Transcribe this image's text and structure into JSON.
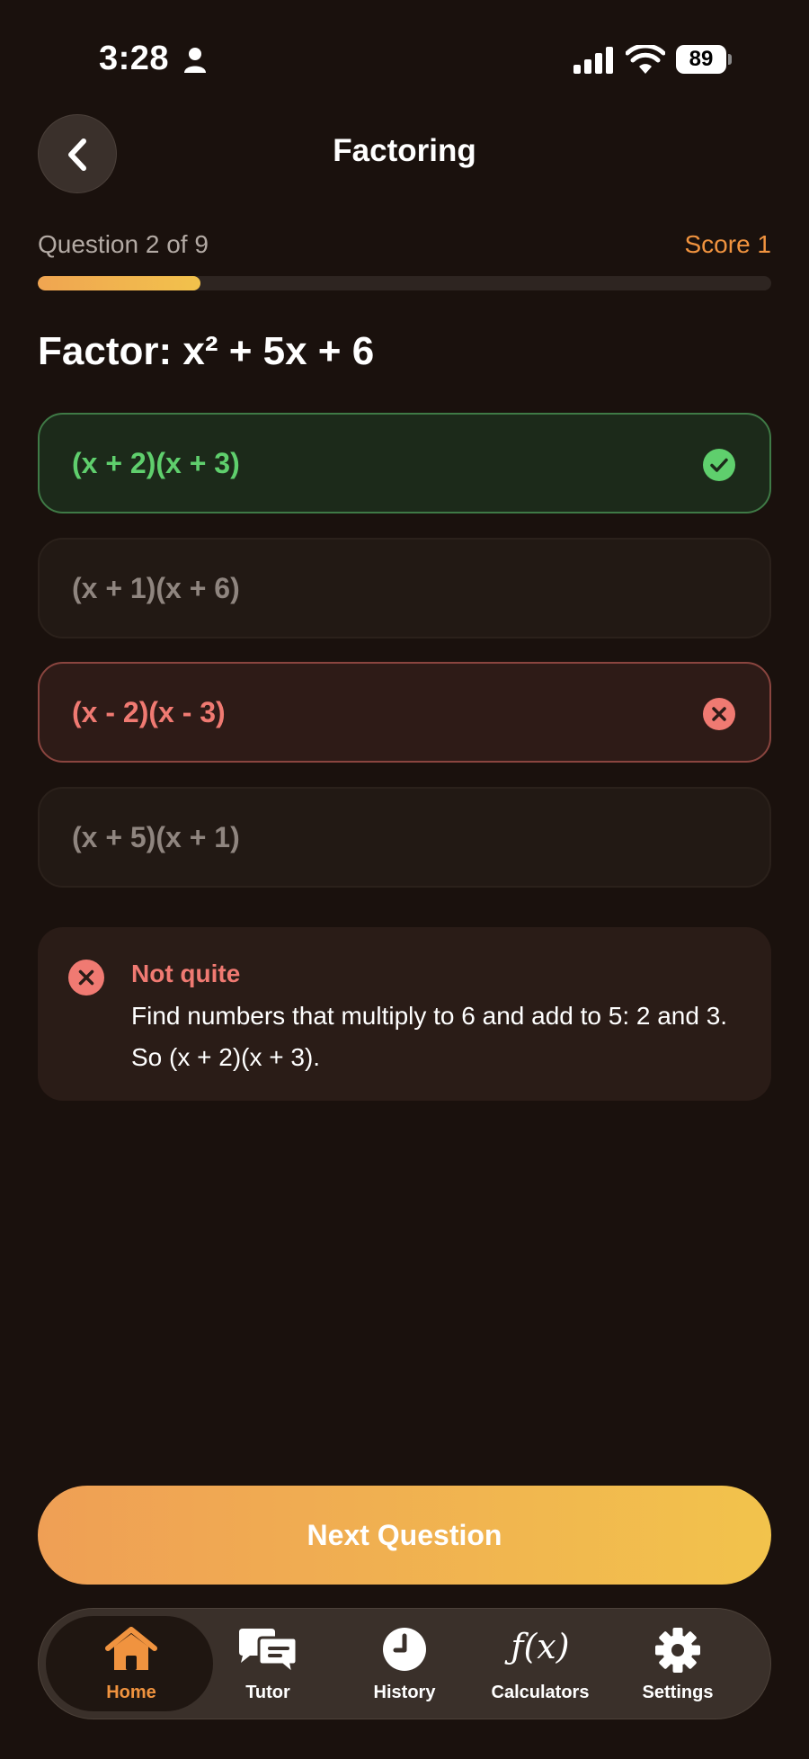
{
  "status_bar": {
    "time": "3:28",
    "battery": "89"
  },
  "header": {
    "title": "Factoring"
  },
  "progress": {
    "question_counter": "Question 2 of 9",
    "score": "Score 1",
    "fraction": 0.222
  },
  "question": {
    "text": "Factor: x² + 5x + 6"
  },
  "options": [
    {
      "label": "(x + 2)(x + 3)",
      "state": "correct"
    },
    {
      "label": "(x + 1)(x + 6)",
      "state": "neutral"
    },
    {
      "label": "(x - 2)(x - 3)",
      "state": "wrong"
    },
    {
      "label": "(x + 5)(x + 1)",
      "state": "neutral"
    }
  ],
  "feedback": {
    "title": "Not quite",
    "body": "Find numbers that multiply to 6 and add to 5: 2 and 3. So (x + 2)(x + 3)."
  },
  "next_button": {
    "label": "Next Question"
  },
  "tab_bar": {
    "items": [
      {
        "label": "Home",
        "icon": "home-icon"
      },
      {
        "label": "Tutor",
        "icon": "chat-bubbles-icon"
      },
      {
        "label": "History",
        "icon": "clock-icon"
      },
      {
        "label": "Calculators",
        "icon": "function-icon",
        "glyph": "ƒ(x)"
      },
      {
        "label": "Settings",
        "icon": "gear-icon"
      }
    ]
  },
  "colors": {
    "background": "#1a110d",
    "accent": "#f0933f",
    "correct": "#5fcf6d",
    "wrong": "#f07a72"
  }
}
